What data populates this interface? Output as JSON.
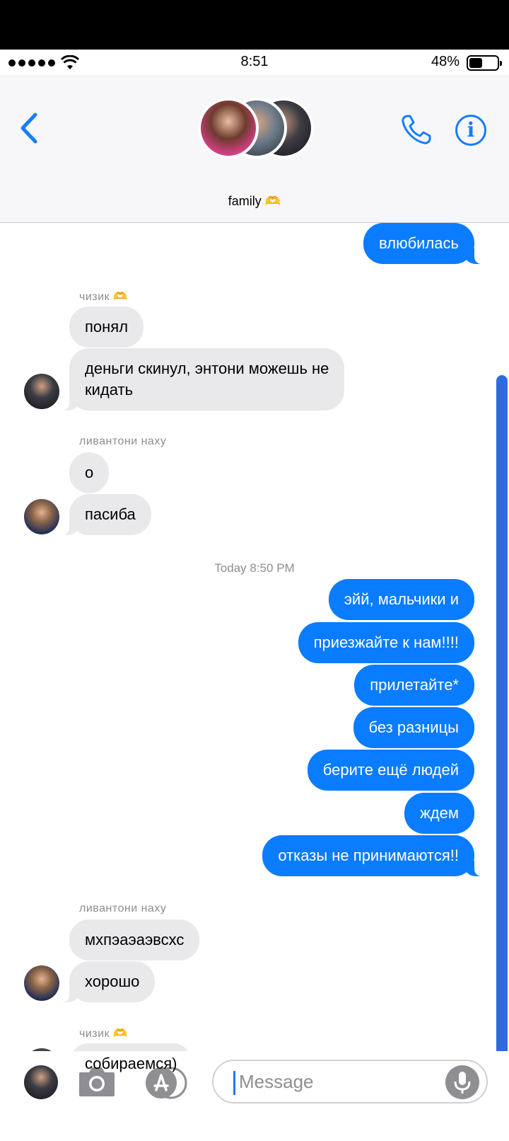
{
  "status_bar": {
    "time": "8:51",
    "battery_percent": "48%",
    "battery_level": 0.48
  },
  "header": {
    "group_name": "family 🫶"
  },
  "messages": [
    {
      "text": "влюбилась",
      "direction": "outgoing"
    },
    {
      "sender": "чизик 🫶",
      "text": "понял",
      "direction": "incoming"
    },
    {
      "text": "деньги скинул, энтони можешь не",
      "text2": "кидать",
      "direction": "incoming"
    },
    {
      "sender": "ливантони наху",
      "text": "о",
      "direction": "incoming"
    },
    {
      "text": "пасиба",
      "direction": "incoming"
    },
    {
      "timestamp": "Today 8:50 PM"
    },
    {
      "text": "эйй, мальчики и",
      "direction": "outgoing"
    },
    {
      "text": "приезжайте к нам!!!!",
      "direction": "outgoing"
    },
    {
      "text": "прилетайте*",
      "direction": "outgoing"
    },
    {
      "text": "без разницы",
      "direction": "outgoing"
    },
    {
      "text": "берите ещё людей",
      "direction": "outgoing"
    },
    {
      "text": "ждем",
      "direction": "outgoing"
    },
    {
      "text": "отказы не принимаются!!",
      "direction": "outgoing"
    },
    {
      "sender": "ливантони наху",
      "text": "мхпэаэаэвсхс",
      "direction": "incoming"
    },
    {
      "text": "хорошо",
      "direction": "incoming"
    },
    {
      "sender": "чизик 🫶",
      "text": "собираемся)",
      "direction": "incoming"
    }
  ],
  "input": {
    "placeholder": "Message"
  },
  "colors": {
    "accent": "#147efb",
    "outgoing_bubble": "#0a7cff",
    "incoming_bubble": "#e9e9eb"
  },
  "icons": [
    "back-chevron-icon",
    "phone-icon",
    "info-icon",
    "camera-icon",
    "app-store-icon",
    "microphone-icon",
    "wifi-icon",
    "battery-icon"
  ]
}
